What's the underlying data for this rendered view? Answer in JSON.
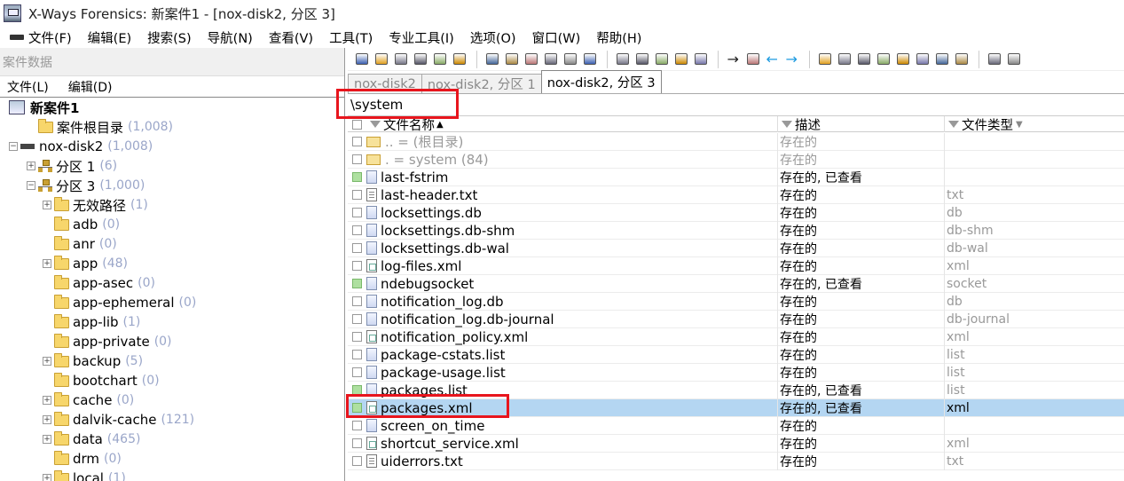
{
  "window": {
    "title": "X-Ways Forensics: 新案件1 - [nox-disk2, 分区 3]"
  },
  "menu": [
    "文件(F)",
    "编辑(E)",
    "搜索(S)",
    "导航(N)",
    "查看(V)",
    "工具(T)",
    "专业工具(I)",
    "选项(O)",
    "窗口(W)",
    "帮助(H)"
  ],
  "left_panel": {
    "title": "案件数据",
    "menu": [
      "文件(L)",
      "编辑(D)"
    ],
    "tree": [
      {
        "label": "新案件1",
        "count": "",
        "level": 0,
        "icon": "case-icon",
        "expander": "",
        "bold": true
      },
      {
        "label": "案件根目录",
        "count": "(1,008)",
        "level": 1,
        "icon": "folder-icon",
        "expander": ""
      },
      {
        "label": "nox-disk2",
        "count": "(1,008)",
        "level": 0,
        "icon": "disk-icon",
        "expander": "−"
      },
      {
        "label": "分区 1",
        "count": "(6)",
        "level": 1,
        "icon": "partition-icon",
        "expander": "+"
      },
      {
        "label": "分区 3",
        "count": "(1,000)",
        "level": 1,
        "icon": "partition-icon",
        "expander": "−"
      },
      {
        "label": "无效路径",
        "count": "(1)",
        "level": 2,
        "icon": "folder-icon",
        "expander": "+"
      },
      {
        "label": "adb",
        "count": "(0)",
        "level": 2,
        "icon": "folder-icon",
        "expander": ""
      },
      {
        "label": "anr",
        "count": "(0)",
        "level": 2,
        "icon": "folder-icon",
        "expander": ""
      },
      {
        "label": "app",
        "count": "(48)",
        "level": 2,
        "icon": "folder-icon",
        "expander": "+"
      },
      {
        "label": "app-asec",
        "count": "(0)",
        "level": 2,
        "icon": "folder-icon",
        "expander": ""
      },
      {
        "label": "app-ephemeral",
        "count": "(0)",
        "level": 2,
        "icon": "folder-icon",
        "expander": ""
      },
      {
        "label": "app-lib",
        "count": "(1)",
        "level": 2,
        "icon": "folder-icon",
        "expander": ""
      },
      {
        "label": "app-private",
        "count": "(0)",
        "level": 2,
        "icon": "folder-icon",
        "expander": ""
      },
      {
        "label": "backup",
        "count": "(5)",
        "level": 2,
        "icon": "folder-icon",
        "expander": "+"
      },
      {
        "label": "bootchart",
        "count": "(0)",
        "level": 2,
        "icon": "folder-icon",
        "expander": ""
      },
      {
        "label": "cache",
        "count": "(0)",
        "level": 2,
        "icon": "folder-icon",
        "expander": "+"
      },
      {
        "label": "dalvik-cache",
        "count": "(121)",
        "level": 2,
        "icon": "folder-icon",
        "expander": "+"
      },
      {
        "label": "data",
        "count": "(465)",
        "level": 2,
        "icon": "folder-icon",
        "expander": "+"
      },
      {
        "label": "drm",
        "count": "(0)",
        "level": 2,
        "icon": "folder-icon",
        "expander": ""
      },
      {
        "label": "local",
        "count": "(1)",
        "level": 2,
        "icon": "folder-icon",
        "expander": "+"
      }
    ]
  },
  "tabs": [
    {
      "label": "nox-disk2",
      "active": false
    },
    {
      "label": "nox-disk2, 分区 1",
      "active": false
    },
    {
      "label": "nox-disk2, 分区 3",
      "active": true
    }
  ],
  "path": "\\system",
  "columns": {
    "name": "文件名称",
    "desc": "描述",
    "type": "文件类型"
  },
  "files": [
    {
      "name": "..  =  (根目录)",
      "desc": "存在的",
      "type": "",
      "icon": "folder",
      "grey": true,
      "checked": false
    },
    {
      "name": ".    =  system (84)",
      "desc": "存在的",
      "type": "",
      "icon": "folder",
      "grey": true,
      "checked": false
    },
    {
      "name": "last-fstrim",
      "desc": "存在的, 已查看",
      "type": "",
      "icon": "file",
      "grey": false,
      "checked": true
    },
    {
      "name": "last-header.txt",
      "desc": "存在的",
      "type": "txt",
      "icon": "text",
      "grey": false,
      "checked": false
    },
    {
      "name": "locksettings.db",
      "desc": "存在的",
      "type": "db",
      "icon": "file",
      "grey": false,
      "checked": false
    },
    {
      "name": "locksettings.db-shm",
      "desc": "存在的",
      "type": "db-shm",
      "icon": "file",
      "grey": false,
      "checked": false
    },
    {
      "name": "locksettings.db-wal",
      "desc": "存在的",
      "type": "db-wal",
      "icon": "file",
      "grey": false,
      "checked": false
    },
    {
      "name": "log-files.xml",
      "desc": "存在的",
      "type": "xml",
      "icon": "xml",
      "grey": false,
      "checked": false
    },
    {
      "name": "ndebugsocket",
      "desc": "存在的, 已查看",
      "type": "socket",
      "icon": "file",
      "grey": false,
      "checked": true
    },
    {
      "name": "notification_log.db",
      "desc": "存在的",
      "type": "db",
      "icon": "file",
      "grey": false,
      "checked": false
    },
    {
      "name": "notification_log.db-journal",
      "desc": "存在的",
      "type": "db-journal",
      "icon": "file",
      "grey": false,
      "checked": false
    },
    {
      "name": "notification_policy.xml",
      "desc": "存在的",
      "type": "xml",
      "icon": "xml",
      "grey": false,
      "checked": false
    },
    {
      "name": "package-cstats.list",
      "desc": "存在的",
      "type": "list",
      "icon": "file",
      "grey": false,
      "checked": false
    },
    {
      "name": "package-usage.list",
      "desc": "存在的",
      "type": "list",
      "icon": "file",
      "grey": false,
      "checked": false
    },
    {
      "name": "packages.list",
      "desc": "存在的, 已查看",
      "type": "list",
      "icon": "file",
      "grey": false,
      "checked": true
    },
    {
      "name": "packages.xml",
      "desc": "存在的, 已查看",
      "type": "xml",
      "icon": "xml",
      "grey": false,
      "checked": true,
      "selected": true
    },
    {
      "name": "screen_on_time",
      "desc": "存在的",
      "type": "",
      "icon": "file",
      "grey": false,
      "checked": false
    },
    {
      "name": "shortcut_service.xml",
      "desc": "存在的",
      "type": "xml",
      "icon": "xml",
      "grey": false,
      "checked": false
    },
    {
      "name": "uiderrors.txt",
      "desc": "存在的",
      "type": "txt",
      "icon": "text",
      "grey": false,
      "checked": false
    }
  ],
  "toolbar_icons": [
    "new-icon",
    "open-folder-icon",
    "save-icon",
    "print-icon",
    "properties-icon",
    "export-icon",
    "sep",
    "undo-icon",
    "copy-icon",
    "paste-icon",
    "paste-special-icon",
    "copy-hex-icon",
    "binary-icon",
    "sep",
    "find-icon",
    "find-next-icon",
    "find-hex-icon",
    "replace-icon",
    "find-all-icon",
    "sep",
    "goto-icon",
    "goto-offset-icon",
    "back-icon",
    "forward-icon",
    "sep",
    "disk-icon",
    "ram-icon",
    "image-icon",
    "calculator-icon",
    "zoom-icon",
    "hash-icon",
    "picture-icon",
    "settings-icon",
    "sep",
    "tree-icon",
    "table-icon"
  ],
  "colors": {
    "selection": "#b4d6f2",
    "highlight_border": "#e8151d",
    "count_text": "#9aa6c9",
    "viewed_check": "#aee0a0"
  }
}
